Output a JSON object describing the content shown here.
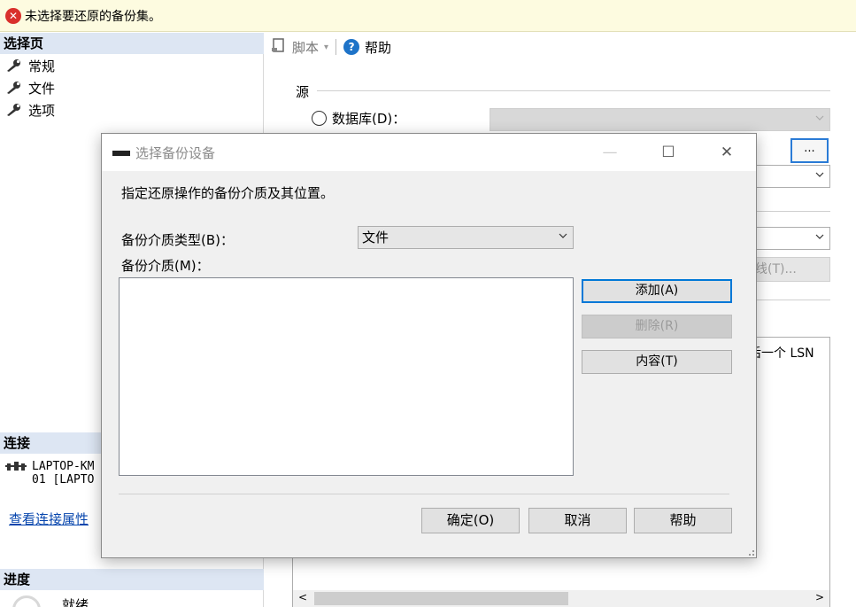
{
  "banner": {
    "message": "未选择要还原的备份集。",
    "icon": "error-icon"
  },
  "left": {
    "select_page_header": "选择页",
    "nav_items": [
      {
        "label": "常规",
        "icon": "wrench-icon"
      },
      {
        "label": "文件",
        "icon": "wrench-icon"
      },
      {
        "label": "选项",
        "icon": "wrench-icon"
      }
    ],
    "connection_header": "连接",
    "connection_lines": [
      "LAPTOP-KM",
      "01 [LAPTO"
    ],
    "connection_link": "查看连接属性",
    "progress_header": "进度",
    "progress_status": "就绪"
  },
  "toolbar": {
    "script_label": "脚本",
    "help_label": "帮助"
  },
  "source": {
    "group_label": "源",
    "database_radio": "数据库(D)：",
    "browse_label": "...",
    "timeline_label": "线(T)...",
    "lsn_fragment": "后一个 LSN"
  },
  "dialog": {
    "title": "选择备份设备",
    "instruction": "指定还原操作的备份介质及其位置。",
    "media_type_label": "备份介质类型(B)：",
    "media_type_value": "文件",
    "media_label": "备份介质(M)：",
    "add_button": "添加(A)",
    "remove_button": "删除(R)",
    "contents_button": "内容(T)",
    "ok_button": "确定(O)",
    "cancel_button": "取消",
    "help_button": "帮助",
    "minimize_glyph": "—",
    "maximize_glyph": "☐",
    "close_glyph": "✕"
  }
}
